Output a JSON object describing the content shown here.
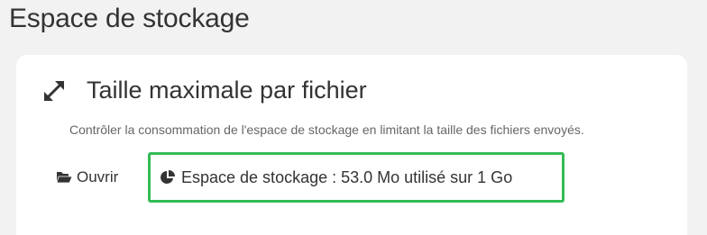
{
  "page": {
    "title": "Espace de stockage"
  },
  "card": {
    "icon": "expand-arrows-icon",
    "title": "Taille maximale par fichier",
    "description": "Contrôler la consommation de l'espace de stockage en limitant la taille des fichiers envoyés."
  },
  "actions": {
    "open_icon": "folder-open-icon",
    "open_label": "Ouvrir",
    "storage_icon": "pie-chart-icon",
    "storage_label": "Espace de stockage : 53.0 Mo utilisé sur 1 Go"
  },
  "colors": {
    "highlight_border": "#33bb55",
    "background": "#f2f2f2",
    "card": "#ffffff",
    "text": "#333333"
  }
}
